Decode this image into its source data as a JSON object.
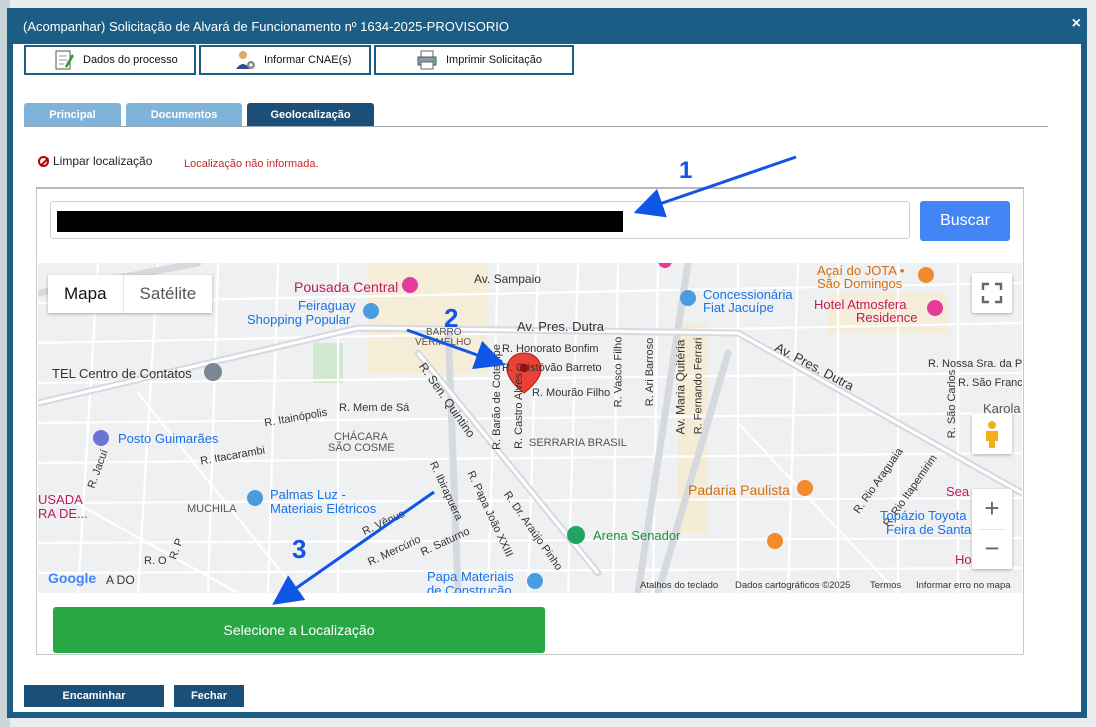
{
  "dialog": {
    "title": "(Acompanhar) Solicitação de Alvará de Funcionamento nº 1634-2025-PROVISORIO",
    "close_glyph": "×"
  },
  "toolbar": [
    {
      "label": "Dados do processo",
      "icon": "edit-document-icon"
    },
    {
      "label": "Informar CNAE(s)",
      "icon": "user-gear-icon"
    },
    {
      "label": "Imprimir Solicitação",
      "icon": "printer-icon"
    }
  ],
  "tabs": [
    {
      "label": "Principal",
      "active": false
    },
    {
      "label": "Documentos",
      "active": false
    },
    {
      "label": "Geolocalização",
      "active": true
    }
  ],
  "geo": {
    "clear_label": "Limpar localização",
    "status": "Localização não informada.",
    "search_button": "Buscar",
    "select_button": "Selecione a Localização"
  },
  "map": {
    "type_buttons": [
      "Mapa",
      "Satélite"
    ],
    "zoom_in": "+",
    "zoom_out": "−",
    "logo": "Google",
    "attribution": [
      "Atalhos do teclado",
      "Dados cartográficos ©2025",
      "Termos",
      "Informar erro no mapa"
    ],
    "labels": {
      "pousada_central": "Pousada Central",
      "av_sampaio": "Av. Sampaio",
      "feiraguay_1": "Feiraguay",
      "feiraguay_2": "Shopping Popular",
      "barro_1": "BARRO",
      "barro_2": "VERMELHO",
      "av_pres_dutra": "Av. Pres. Dutra",
      "av_pres_dutra_2": "Av. Pres. Dutra",
      "honorato": "R. Honorato Bonfim",
      "cristovao": "R. Cristóvão Barreto",
      "mourao": "R. Mourão Filho",
      "tel": "TEL Centro de Contatos",
      "itainopolis": "R. Itainópolis",
      "mem_de_sa": "R. Mem de Sá",
      "sen_quintino": "R. Sen. Quintino",
      "barao": "R. Barão de Cotegipe",
      "castro_alves": "R. Castro Alves",
      "vasco": "R. Vasco Filho",
      "ari_barroso": "R. Ari Barroso",
      "maria_quiteria": "Av. Maria Quitéria",
      "fernando_ferrari": "R. Fernando Ferrari",
      "posto": "Posto Guimarães",
      "chacara_1": "CHÁCARA",
      "chacara_2": "SÃO COSME",
      "itacarambi": "R. Itacarambi",
      "serraria": "SERRARIA BRASIL",
      "concessionaria_1": "Concessionária",
      "concessionaria_2": "Fiat Jacuípe",
      "acai_1": "Açaí do JOTA •",
      "acai_2": "São Domingos",
      "hotel_1": "Hotel Atmosfera",
      "hotel_2": "Residence",
      "nossa_sra": "R. Nossa Sra. da Pe",
      "sao_franci": "R. São Franci",
      "sao_carlos": "R. São Carlos",
      "karola": "Karola",
      "palmas_1": "Palmas Luz -",
      "palmas_2": "Materiais Elétricos",
      "padaria": "Padaria Paulista",
      "rio_araguaia": "R. Rio Araguaia",
      "rio_itapemirim": "R. Rio Itapemirim",
      "topazio_1": "Topázio Toyota",
      "topazio_2": "Feira de Santa",
      "arena": "Arena Senador",
      "papa_1": "Papa Materiais",
      "papa_2": "de Construção",
      "musada_1": "USADA",
      "musada_2": "RA DE...",
      "muchila": "MUCHILA",
      "ibirapuera": "R. Ibirapuera",
      "papa_joao": "R. Papa João XXIII",
      "araujo_pinho": "R. Dr. Araújo Pinho",
      "venus": "R. Vênus",
      "mercurio": "R. Mercúrio",
      "saturno": "R. Saturno",
      "anda_do": "A DO",
      "sea": "Sea",
      "ho": "Ho",
      "jacui": "R. Jacuí",
      "r_o": "R. O",
      "r_p": "R. P"
    }
  },
  "annotations": [
    "1",
    "2",
    "3"
  ],
  "footer": {
    "forward": "Encaminhar",
    "close": "Fechar"
  },
  "colors": {
    "brand": "#1b5d85",
    "tab_inactive": "#7fb3d9",
    "tab_active": "#1b4f78",
    "search_button": "#4285f4",
    "select_button": "#28a745",
    "annotation": "#1155e6",
    "marker": "#ea4335"
  }
}
